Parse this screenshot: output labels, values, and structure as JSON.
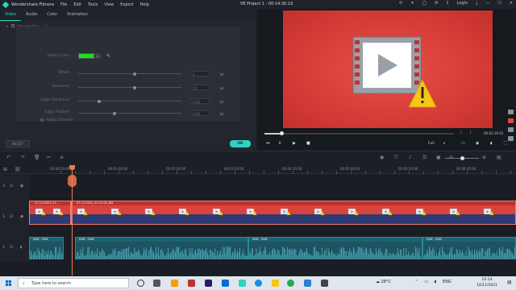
{
  "titlebar": {
    "app_name": "Wondershare Filmora",
    "menus": [
      "File",
      "Edit",
      "Tools",
      "View",
      "Export",
      "Help"
    ],
    "project_title": "VE Project 1 : 00:14:30:10",
    "login": "Login",
    "notification_count": "1"
  },
  "editor": {
    "tabs": [
      "Video",
      "Audio",
      "Color",
      "Animation"
    ],
    "active_tab": "Video",
    "section": "Chroma Key",
    "select_color_label": "Select Color:",
    "select_color_value": "#19e01b",
    "params": [
      {
        "label": "Offset:",
        "value": "0",
        "level": 0.55
      },
      {
        "label": "Tolerance:",
        "value": "50",
        "level": 0.55
      },
      {
        "label": "Edge Thickness:",
        "value": "0.00",
        "level": 0.2
      },
      {
        "label": "Edge Feather:",
        "value": "0.00",
        "level": 0.35
      }
    ],
    "alpha_channel_label": "Alpha Channel",
    "reset_label": "RESET",
    "ok_label": "OK"
  },
  "preview": {
    "timecode": "00:01:19:41",
    "progress": 0.09,
    "quality": "Full"
  },
  "ruler": {
    "ticks": [
      "00:00:50:00",
      "00:01:40:00",
      "00:02:30:00",
      "00:03:20:00",
      "00:04:10:00",
      "00:05:00:00",
      "00:05:50:00",
      "00:06:40:00"
    ]
  },
  "timeline": {
    "video_clips": [
      {
        "label": "07-11-2021_21...",
        "width_note": "short"
      },
      {
        "label": "07-11-2021_21-21-01_HD",
        "width_note": "long"
      }
    ],
    "audio_clips": [
      {
        "label": "Drift - Drift"
      },
      {
        "label": "Drift - Drift"
      },
      {
        "label": "Drift - Drift"
      },
      {
        "label": "Drift - Drift"
      }
    ],
    "track_numbers": [
      "2",
      "1",
      "1"
    ]
  },
  "taskbar": {
    "search_placeholder": "Type here to search",
    "temperature": "28°C",
    "language": "ENG",
    "time": "23:14",
    "date": "14/11/2021"
  },
  "colors": {
    "accent": "#2fd3c0",
    "video_clip": "#d9433e",
    "audio_clip": "#1f5360",
    "playhead": "#f07a50",
    "preview_bg": "#d63c37"
  }
}
